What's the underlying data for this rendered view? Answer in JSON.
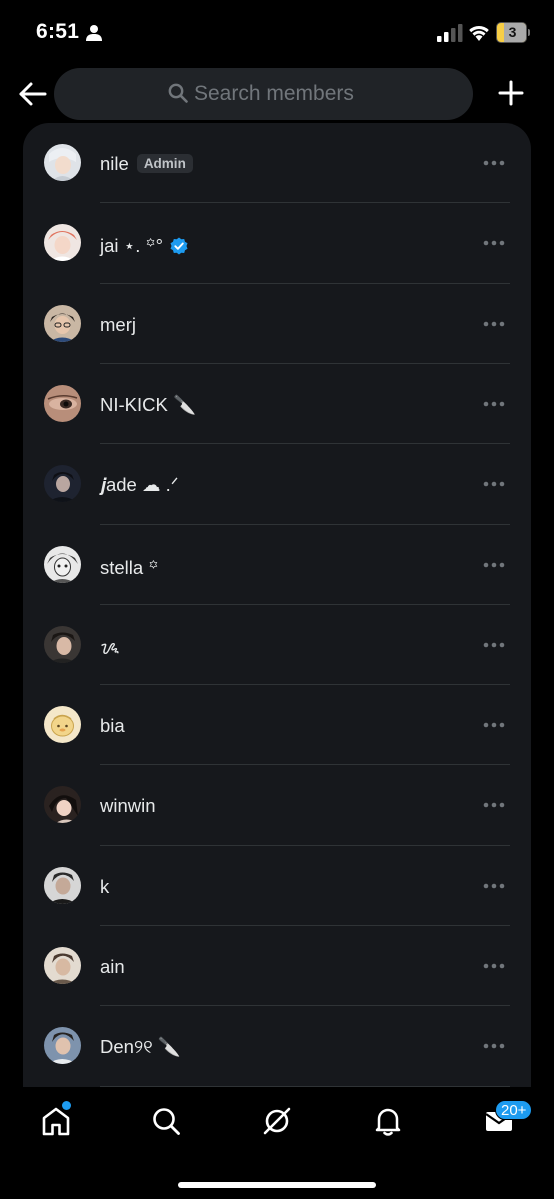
{
  "status_bar": {
    "time": "6:51",
    "battery_level": "3",
    "icons": [
      "person-icon",
      "signal-icon",
      "wifi-icon",
      "battery-icon"
    ]
  },
  "header": {
    "back_icon": "arrow-left-icon",
    "search_placeholder": "Search members",
    "add_icon": "plus-icon"
  },
  "members": [
    {
      "name": "nile",
      "badge": "Admin"
    },
    {
      "name": "jai ⋆. ꙳°",
      "verified": true
    },
    {
      "name": "merj"
    },
    {
      "name": "NI-KICK 🔪"
    },
    {
      "name": "𝒋ade ☁︎ .ᐟ"
    },
    {
      "name": "stella ꙳"
    },
    {
      "name": "ᝰ"
    },
    {
      "name": "bia"
    },
    {
      "name": "winwin"
    },
    {
      "name": "k"
    },
    {
      "name": "ain"
    },
    {
      "name": "Den୨୧ 🔪"
    }
  ],
  "bottom_nav": {
    "items": [
      "home-icon",
      "search-icon",
      "grok-icon",
      "notifications-icon",
      "messages-icon"
    ],
    "messages_badge": "20+"
  },
  "colors": {
    "background": "#000000",
    "card": "#16181c",
    "search_bar": "#202327",
    "accent": "#1d9bf0",
    "text": "#e7e9ea",
    "muted": "#71767b"
  }
}
